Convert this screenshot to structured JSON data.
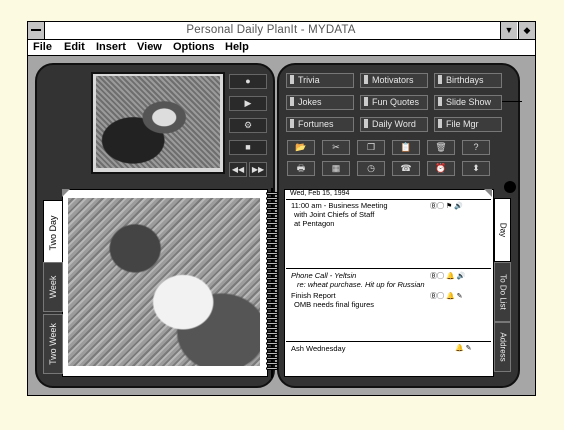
{
  "window": {
    "title": "Personal Daily PlanIt - MYDATA"
  },
  "menu": [
    "File",
    "Edit",
    "Insert",
    "View",
    "Options",
    "Help"
  ],
  "nav_buttons": [
    "Trivia",
    "Motivators",
    "Birthdays",
    "Jokes",
    "Fun Quotes",
    "Slide Show",
    "Fortunes",
    "Daily Word",
    "File Mgr"
  ],
  "video_controls": {
    "record": "●",
    "play": "▶",
    "stop": "■"
  },
  "left_tabs": [
    "Two Day",
    "Week",
    "Two Week"
  ],
  "right_tabs": [
    "Day",
    "To Do List",
    "Address"
  ],
  "page": {
    "date": "Wed, Feb 15, 1994",
    "entries": [
      {
        "line1": "11:00 am - Business Meeting",
        "line2": "with Joint Chiefs of Staff",
        "line3": "at Pentagon"
      },
      {
        "line1": "Phone Call - Yeltsin",
        "line2": "re: wheat purchase. Hit up for Russian",
        "line3": ""
      },
      {
        "line1": "Finish Report",
        "line2": "OMB needs final figures",
        "line3": ""
      },
      {
        "line1": "Ash Wednesday",
        "line2": "",
        "line3": ""
      }
    ]
  },
  "colors": {
    "background": "#fcfbe2",
    "window": "#9a9a9a",
    "book": "#333333",
    "page": "#ffffff"
  }
}
